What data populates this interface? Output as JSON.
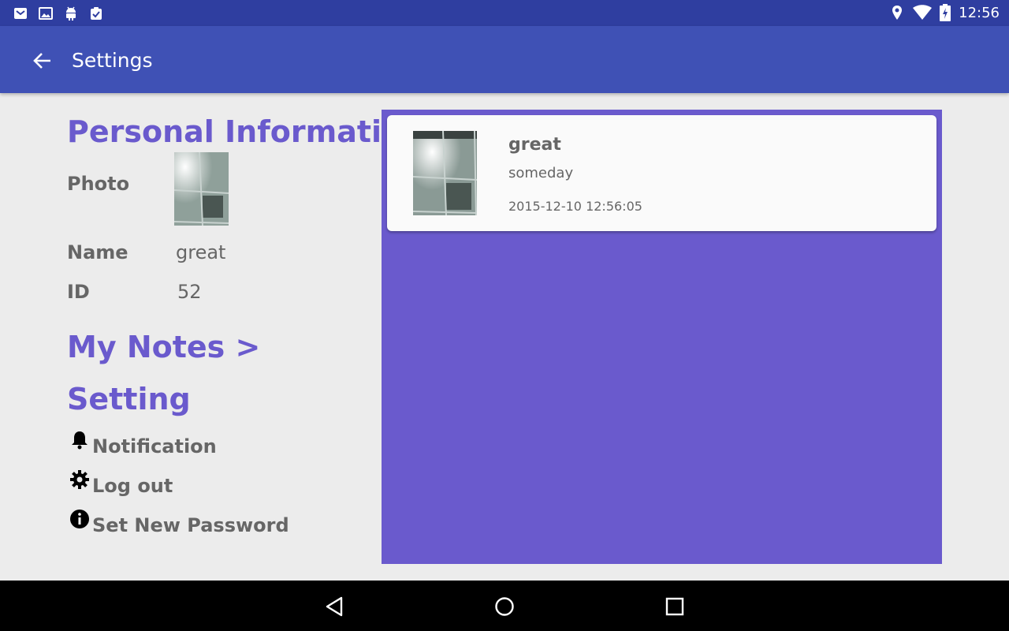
{
  "status_bar": {
    "time": "12:56",
    "left_icons": [
      "mail-icon",
      "image-icon",
      "android-icon",
      "clipboard-check-icon"
    ],
    "right_icons": [
      "location-icon",
      "wifi-icon",
      "battery-charging-icon"
    ]
  },
  "app_bar": {
    "title": "Settings",
    "back_icon": "back-arrow-icon"
  },
  "personal": {
    "section_title": "Personal Information",
    "photo_label": "Photo",
    "name_label": "Name",
    "name_value": "great",
    "id_label": "ID",
    "id_value": "52"
  },
  "notes_link": "My Notes >",
  "settings": {
    "section_title": "Setting",
    "items": [
      {
        "label": "Notification",
        "icon": "bell-icon"
      },
      {
        "label": "Log out",
        "icon": "gear-icon"
      },
      {
        "label": "Set New Password",
        "icon": "info-icon"
      }
    ]
  },
  "notes": [
    {
      "title": "great",
      "subtitle": "someday",
      "date": "2015-12-10 12:56:05"
    }
  ],
  "colors": {
    "status_bar": "#2f3ea0",
    "app_bar": "#3f51b5",
    "accent": "#6a5acd",
    "background": "#ececec"
  },
  "nav_bar": {
    "buttons": [
      "back-triangle-icon",
      "home-circle-icon",
      "recents-square-icon"
    ]
  }
}
